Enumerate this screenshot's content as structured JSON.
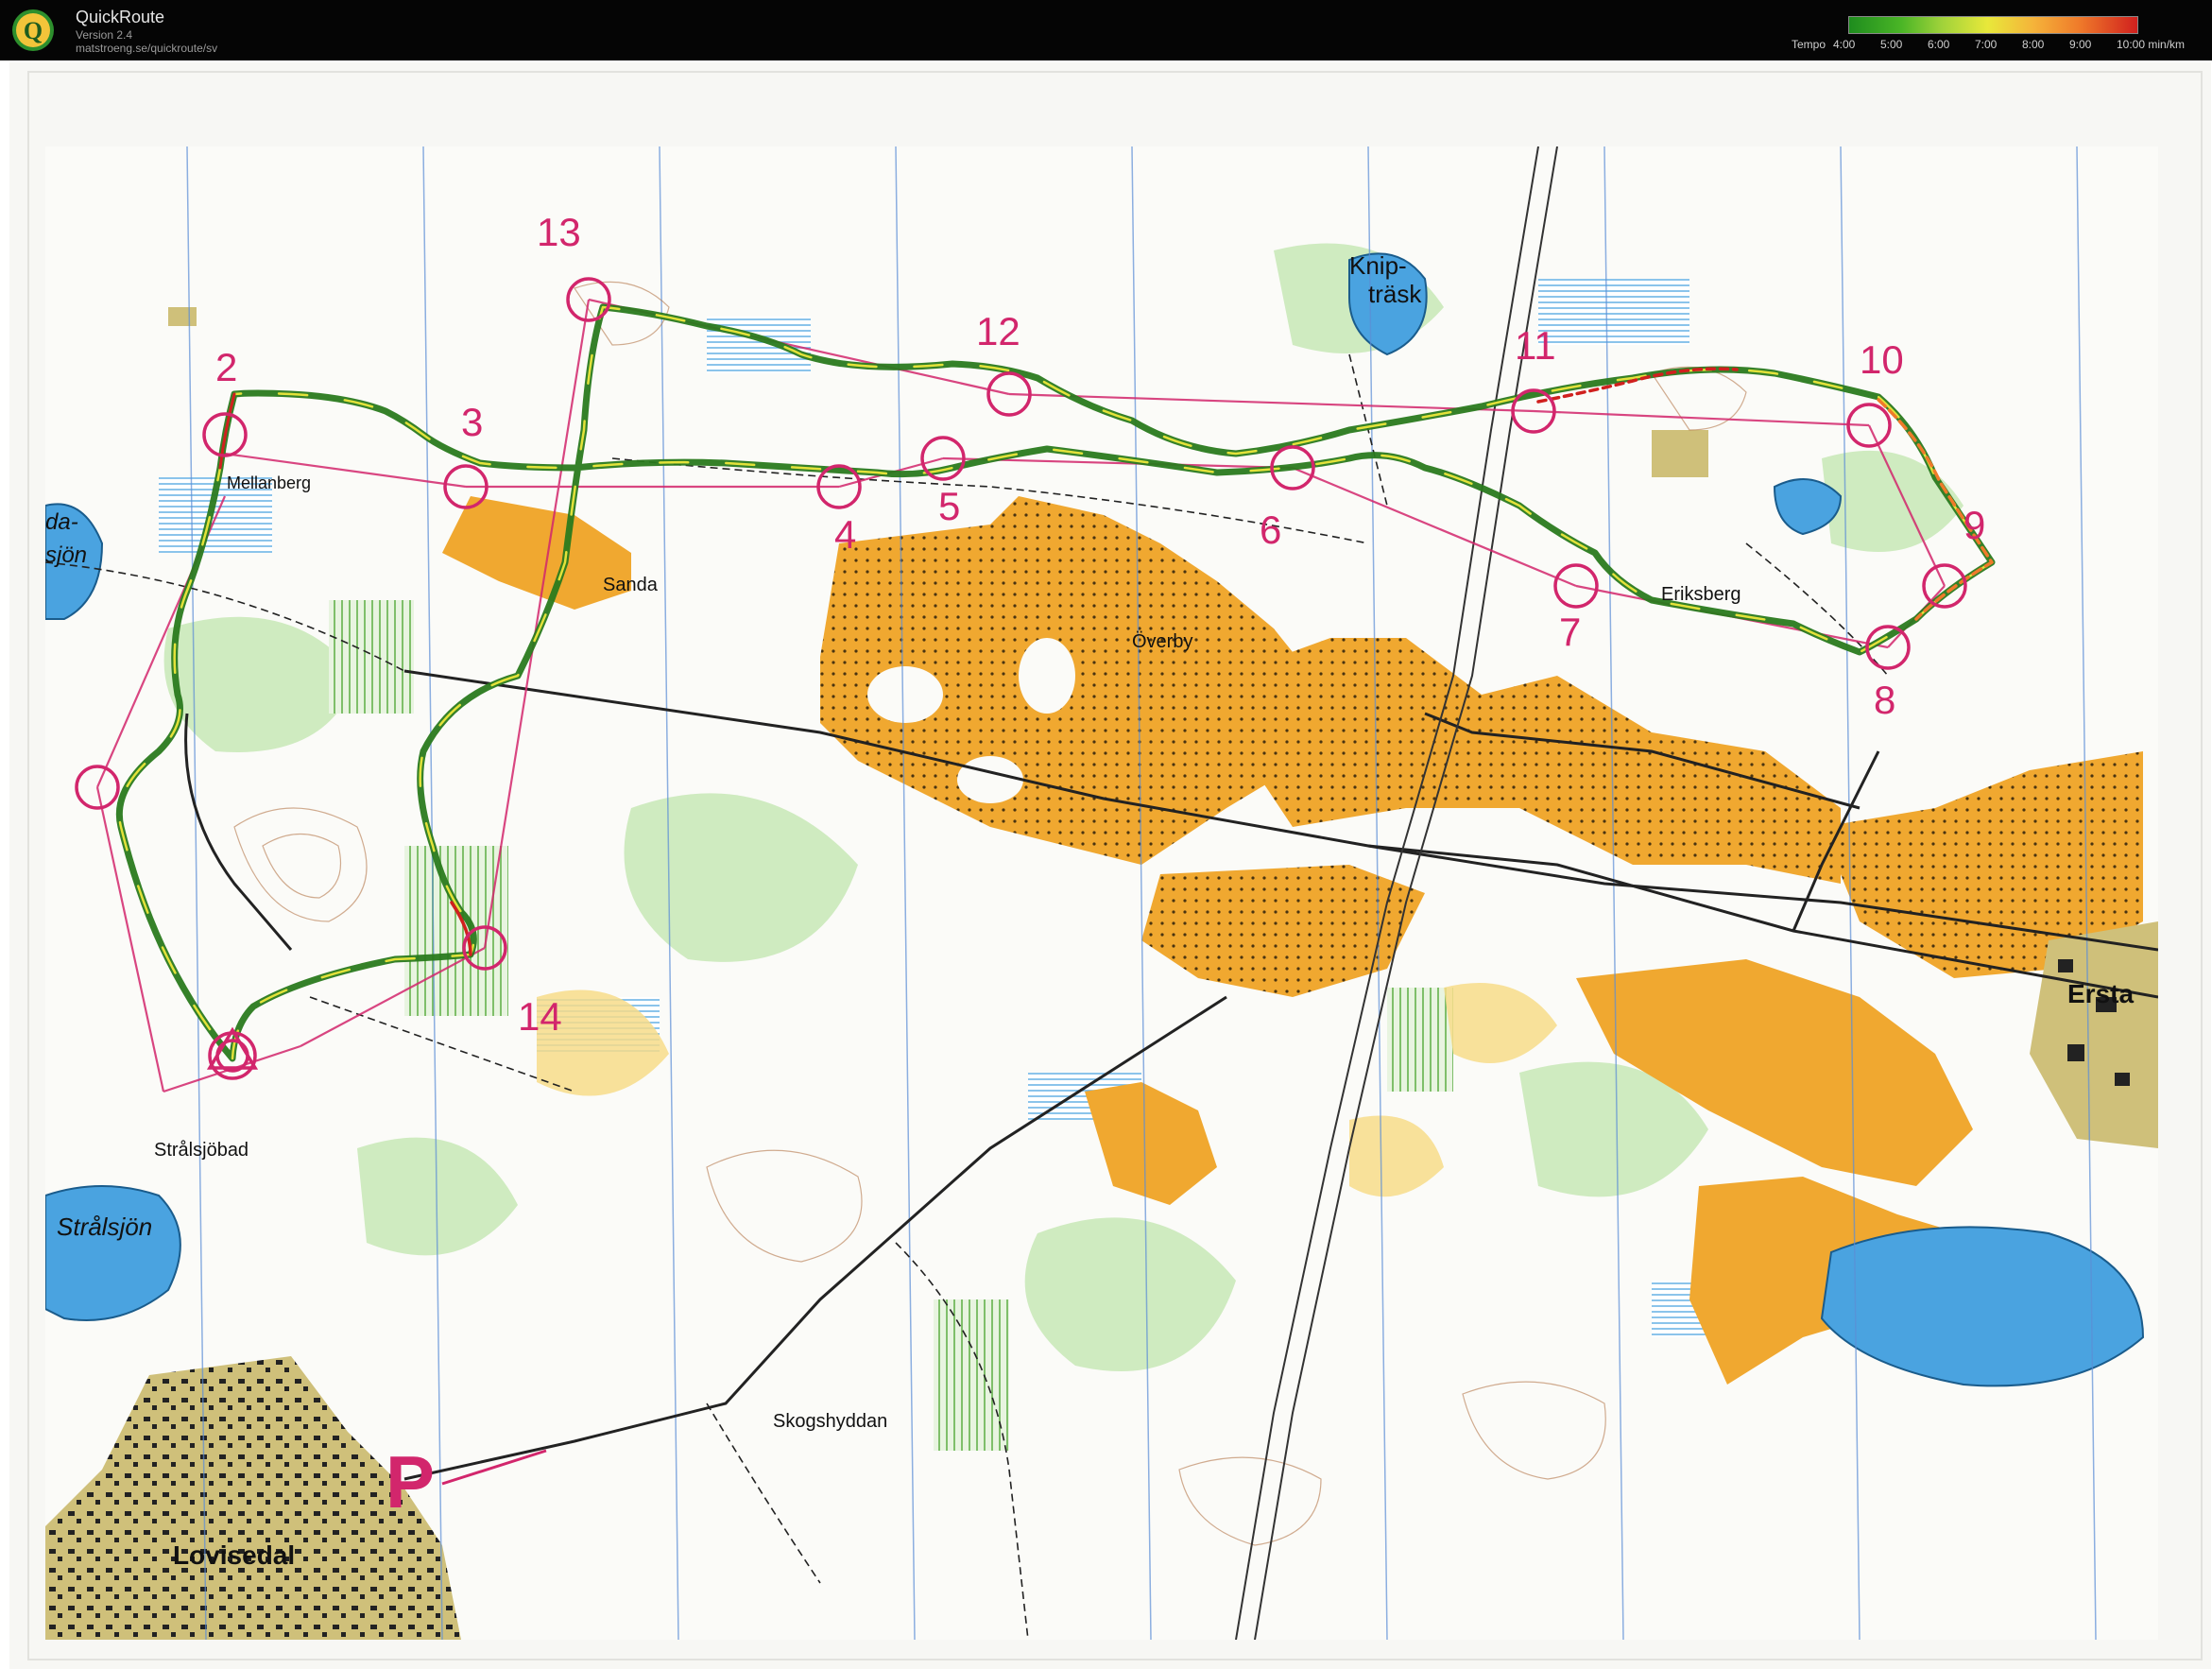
{
  "app": {
    "title": "QuickRoute",
    "version": "Version 2.4",
    "url": "matstroeng.se/quickroute/sv",
    "logo_letter": "Q"
  },
  "tempo": {
    "label": "Tempo",
    "ticks": [
      "4:00",
      "5:00",
      "6:00",
      "7:00",
      "8:00",
      "9:00",
      "10:00 min/km"
    ]
  },
  "map": {
    "place_labels": [
      "Knip-",
      "träsk",
      "Mellanberg",
      "Sanda",
      "Överby",
      "Eriksberg",
      "Ersta",
      "Strålsjöbad",
      "Strålsjön",
      "Skogshyddan",
      "Lovisedal",
      "da-",
      "sjön"
    ],
    "start_symbol": "start-triangle",
    "parking_symbol": "P",
    "control_numbers": [
      "2",
      "3",
      "4",
      "5",
      "6",
      "7",
      "8",
      "9",
      "10",
      "11",
      "12",
      "13",
      "14"
    ],
    "colors": {
      "course": "#d2266c",
      "route_slow": "#d0201e",
      "route_fast": "#1e8c1e",
      "field_orange": "#f0a830",
      "water_blue": "#4aa3e0",
      "forest_green": "#bfe3b0",
      "settlement": "#cfc07a"
    }
  }
}
